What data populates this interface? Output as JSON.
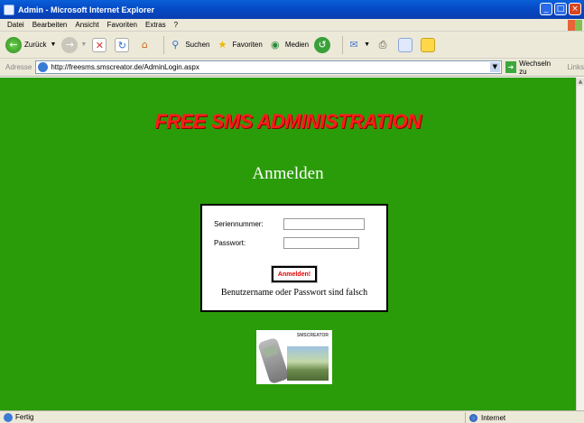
{
  "window": {
    "title": "Admin - Microsoft Internet Explorer",
    "buttons": [
      "_",
      "□",
      "×"
    ]
  },
  "menu": [
    "Datei",
    "Bearbeiten",
    "Ansicht",
    "Favoriten",
    "Extras",
    "?"
  ],
  "toolbar": {
    "back": "Zurück",
    "search": "Suchen",
    "favorites": "Favoriten",
    "media": "Medien"
  },
  "address": {
    "label": "Adresse",
    "url": "http://freesms.smscreator.de/AdminLogin.aspx",
    "go": "Wechseln zu",
    "links": "Links"
  },
  "page": {
    "banner": "FREE SMS ADMINISTRATION",
    "heading": "Anmelden",
    "serial_label": "Seriennummer:",
    "serial_value": "",
    "password_label": "Passwort:",
    "password_value": "",
    "login_button": "Anmelden!",
    "error": "Benutzername oder Passwort sind falsch",
    "logo_brand": "SMSCREATOR"
  },
  "status": {
    "text": "Fertig",
    "zone": "Internet"
  },
  "colors": {
    "page_background": "#2a9c09",
    "banner": "#ff1a1a",
    "button_text": "#e00000"
  }
}
